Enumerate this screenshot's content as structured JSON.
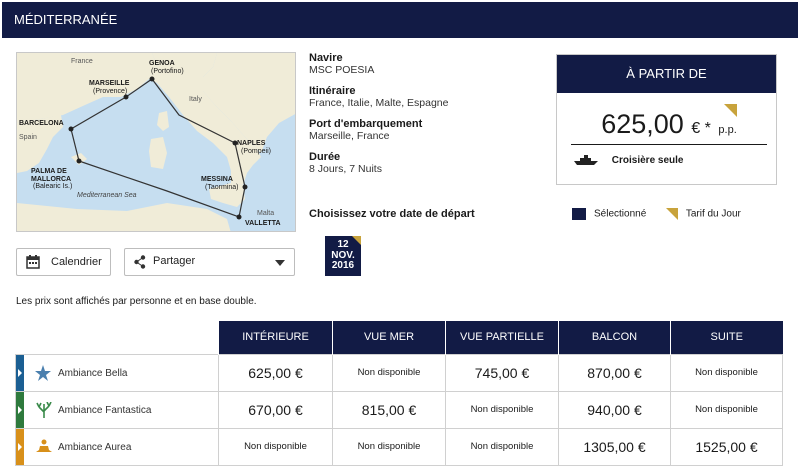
{
  "header": {
    "title": "MÉDITERRANÉE"
  },
  "map": {
    "labels": {
      "france": "France",
      "italy": "Italy",
      "spain": "Spain",
      "malta": "Malta",
      "sea": "Mediterranean Sea",
      "genoa": "GENOA",
      "genoa_sub": "(Portofino)",
      "marseille": "MARSEILLE",
      "marseille_sub": "(Provence)",
      "barcelona": "BARCELONA",
      "palma": "PALMA DE",
      "palma2": "MALLORCA",
      "palma_sub": "(Balearic Is.)",
      "naples": "NAPLES",
      "naples_sub": "(Pompeii)",
      "messina": "MESSINA",
      "messina_sub": "(Taormina)",
      "valletta": "VALLETTA"
    }
  },
  "info": {
    "ship_label": "Navire",
    "ship_value": "MSC POESIA",
    "itinerary_label": "Itinéraire",
    "itinerary_value": "France, Italie, Malte, Espagne",
    "port_label": "Port d'embarquement",
    "port_value": "Marseille, France",
    "duration_label": "Durée",
    "duration_value": "8 Jours, 7 Nuits",
    "choose_label": "Choisissez votre date de départ"
  },
  "date_chip": {
    "day": "12",
    "month": "NOV.",
    "year": "2016"
  },
  "price_box": {
    "header": "À PARTIR DE",
    "amount": "625,00",
    "currency": "€ *",
    "per": "p.p.",
    "cruise_only": "Croisière seule"
  },
  "legend": {
    "selected": "Sélectionné",
    "daily_rate": "Tarif du Jour"
  },
  "buttons": {
    "calendar": "Calendrier",
    "share": "Partager"
  },
  "note": "Les prix sont affichés par personne et en base double.",
  "table": {
    "columns": [
      "INTÉRIEURE",
      "VUE MER",
      "VUE PARTIELLE",
      "BALCON",
      "SUITE"
    ],
    "rows": [
      {
        "name": "Ambiance Bella",
        "color": "#1b5f93",
        "cells": [
          "625,00 €",
          "Non disponible",
          "745,00 €",
          "870,00 €",
          "Non disponible"
        ]
      },
      {
        "name": "Ambiance Fantastica",
        "color": "#2e7a3d",
        "cells": [
          "670,00 €",
          "815,00 €",
          "Non disponible",
          "940,00 €",
          "Non disponible"
        ]
      },
      {
        "name": "Ambiance Aurea",
        "color": "#d8901a",
        "cells": [
          "Non disponible",
          "Non disponible",
          "Non disponible",
          "1305,00 €",
          "1525,00 €"
        ]
      }
    ]
  },
  "colors": {
    "navy": "#121b45",
    "gold": "#c8a33c"
  }
}
